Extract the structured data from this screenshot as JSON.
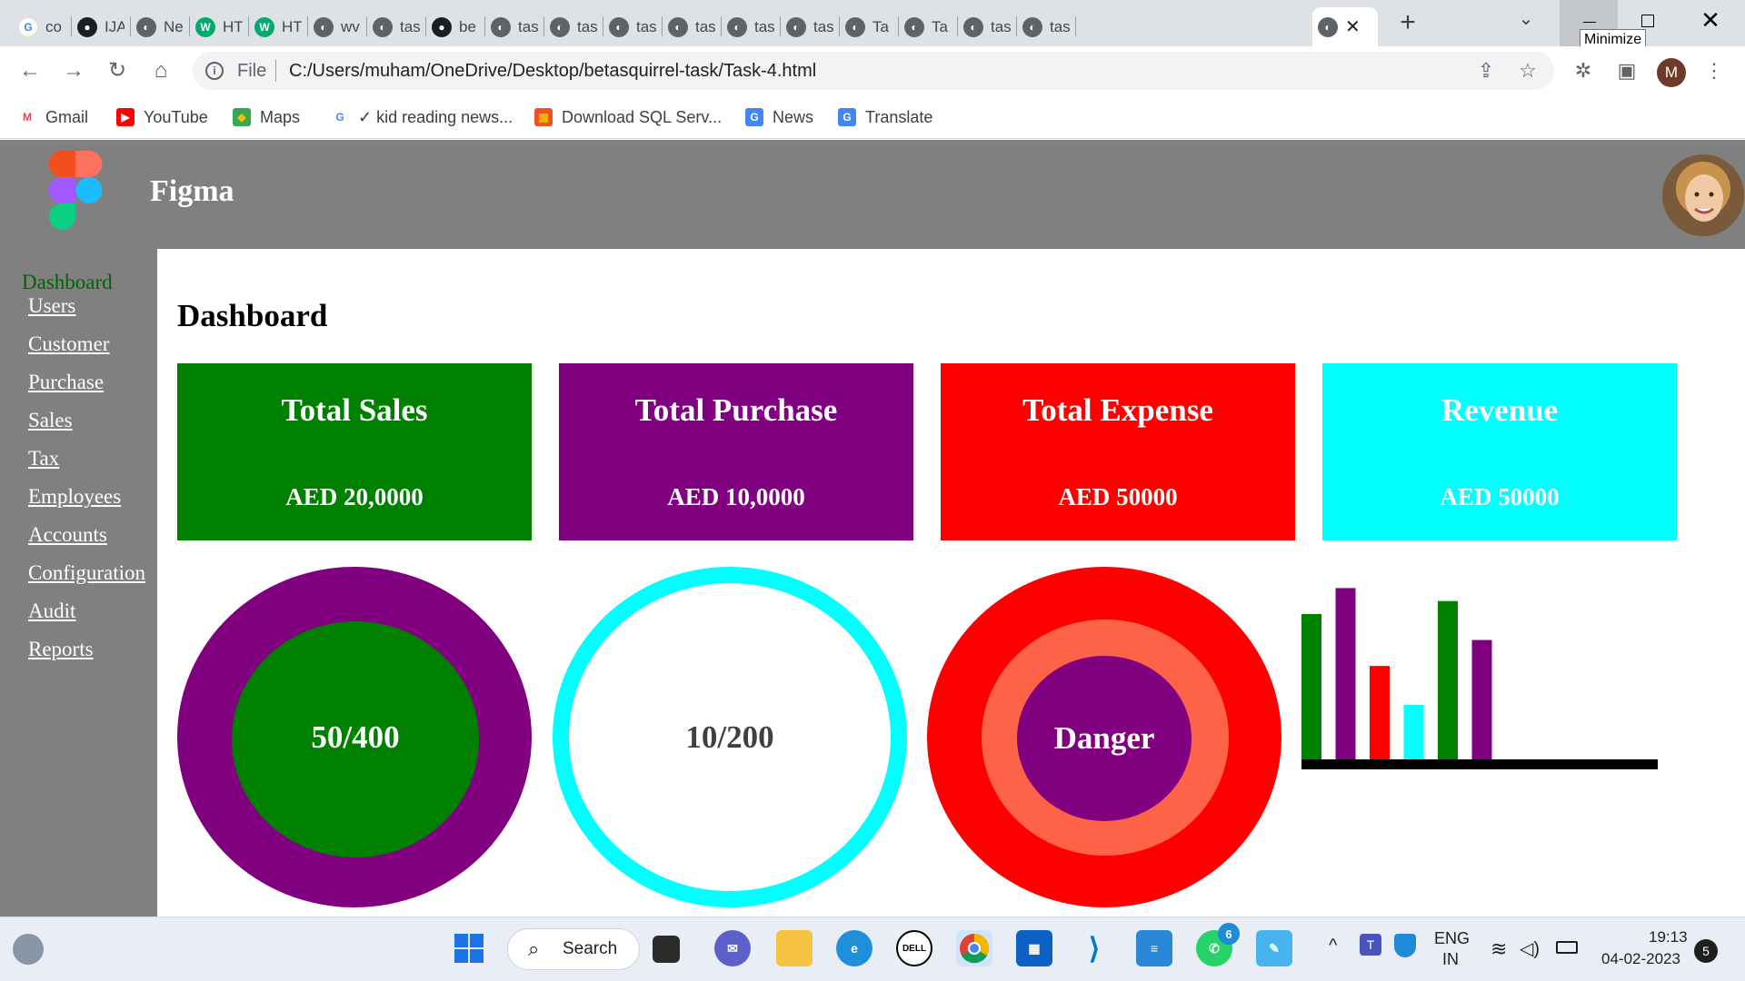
{
  "browser": {
    "tabs": [
      {
        "icon": "google-icon",
        "title": "co"
      },
      {
        "icon": "github-icon",
        "title": "IJA"
      },
      {
        "icon": "globe-icon",
        "title": "Ne"
      },
      {
        "icon": "w3schools-icon",
        "title": "HT"
      },
      {
        "icon": "w3schools-icon",
        "title": "HT"
      },
      {
        "icon": "globe-icon",
        "title": "wv"
      },
      {
        "icon": "globe-icon",
        "title": "tas"
      },
      {
        "icon": "github-icon",
        "title": "be"
      },
      {
        "icon": "globe-icon",
        "title": "tas"
      },
      {
        "icon": "globe-icon",
        "title": "tas"
      },
      {
        "icon": "globe-icon",
        "title": "tas"
      },
      {
        "icon": "globe-icon",
        "title": "tas"
      },
      {
        "icon": "globe-icon",
        "title": "tas"
      },
      {
        "icon": "globe-icon",
        "title": "tas"
      },
      {
        "icon": "globe-icon",
        "title": "Ta"
      },
      {
        "icon": "globe-icon",
        "title": "Ta"
      },
      {
        "icon": "globe-icon",
        "title": "tas"
      },
      {
        "icon": "globe-icon",
        "title": "tas"
      }
    ],
    "tooltip": "Minimize",
    "address": {
      "scheme": "File",
      "url": "C:/Users/muham/OneDrive/Desktop/betasquirrel-task/Task-4.html"
    },
    "profile_initial": "M",
    "bookmarks": [
      {
        "icon": "gmail-icon",
        "label": "Gmail"
      },
      {
        "icon": "youtube-icon",
        "label": "YouTube"
      },
      {
        "icon": "maps-icon",
        "label": "Maps"
      },
      {
        "icon": "google-icon",
        "label": "✓ kid reading news..."
      },
      {
        "icon": "microsoft-icon",
        "label": "Download SQL Serv..."
      },
      {
        "icon": "news-icon",
        "label": "News"
      },
      {
        "icon": "translate-icon",
        "label": "Translate"
      }
    ]
  },
  "header": {
    "brand": "Figma"
  },
  "sidebar": {
    "title": "Dashboard",
    "links": [
      "Users",
      "Customer",
      "Purchase",
      "Sales",
      "Tax",
      "Employees",
      "Accounts",
      "Configuration",
      "Audit",
      "Reports"
    ]
  },
  "main": {
    "title": "Dashboard",
    "cards": [
      {
        "title": "Total Sales",
        "value": "AED 20,0000",
        "color": "#008000"
      },
      {
        "title": "Total Purchase",
        "value": "AED 10,0000",
        "color": "#800080"
      },
      {
        "title": "Total Expense",
        "value": "AED 50000",
        "color": "#ff0000"
      },
      {
        "title": "Revenue",
        "value": "AED 50000",
        "color": "#00ffff"
      }
    ],
    "circles": [
      {
        "label": "50/400",
        "outer": "#800080",
        "inner": "#008000"
      },
      {
        "label": "10/200",
        "ring": "#00ffff"
      },
      {
        "label": "Danger",
        "outer": "#ff0000",
        "middle": "#ff6347",
        "inner": "#800080"
      }
    ]
  },
  "chart_data": {
    "type": "bar",
    "values": [
      56,
      66,
      36,
      21,
      61,
      46
    ],
    "colors": [
      "#008000",
      "#800080",
      "#ff0000",
      "#00ffff",
      "#008000",
      "#800080"
    ],
    "ylim": [
      0,
      70
    ]
  },
  "taskbar": {
    "search_label": "Search",
    "whatsapp_badge": "6",
    "lang": "ENG",
    "region": "IN",
    "time": "19:13",
    "date": "04-02-2023",
    "notifications": "5"
  }
}
